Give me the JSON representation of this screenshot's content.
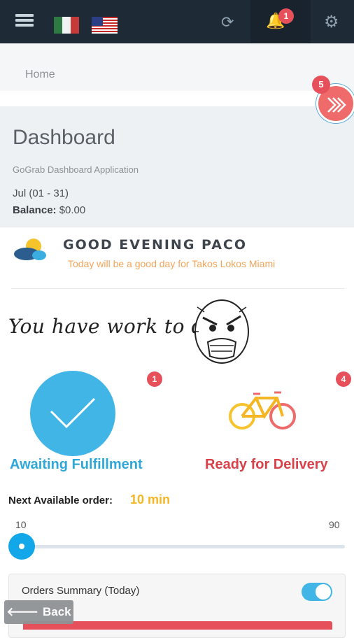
{
  "topbar": {
    "notification_count": "1",
    "icons": [
      "menu-icon",
      "mexico-flag-icon",
      "usa-flag-icon",
      "refresh-icon",
      "bell-icon",
      "gear-icon"
    ]
  },
  "breadcrumb": {
    "home": "Home"
  },
  "quick_action": {
    "badge": "5"
  },
  "dashboard": {
    "title": "Dashboard",
    "subtitle": "GoGrab Dashboard Application",
    "date_range": "Jul (01 - 31)",
    "balance_label": "Balance:",
    "balance_value": "$0.00"
  },
  "greeting": {
    "title": "GOOD EVENING PACO",
    "subtitle": "Today will be a good day for Takos Lokos Miami"
  },
  "work_message": "You have work to do!",
  "status": {
    "awaiting_label": "Awaiting Fulfillment",
    "awaiting_count": "1",
    "ready_label": "Ready for Delivery",
    "ready_count": "4"
  },
  "next_order": {
    "label": "Next Available order:",
    "value": "10 min",
    "slider_min": "10",
    "slider_max": "90",
    "slider_value": 10
  },
  "orders_summary": {
    "title": "Orders Summary (Today)",
    "toggle_on": true
  },
  "back_button": {
    "arrow": "🡐",
    "label": "Back"
  },
  "colors": {
    "topbar": "#1e2a36",
    "accent_blue": "#41b6e6",
    "accent_red": "#e5505a",
    "accent_orange": "#f2a55a",
    "accent_yellow": "#f5b623"
  }
}
